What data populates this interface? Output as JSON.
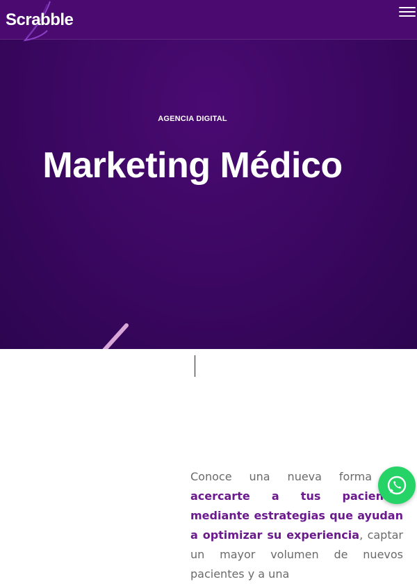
{
  "header": {
    "logo_text": "Scrabble",
    "menu_icon": "hamburger-icon"
  },
  "hero": {
    "eyebrow": "AGENCIA DIGITAL",
    "title": "Marketing Médico"
  },
  "intro": {
    "part1": "Conoce una nueva forma de ",
    "bold": "acercarte a tus pacientes mediante estrategias que ayudan a optimizar su experiencia",
    "part2": ", captar un mayor volumen de nuevos pacientes y a una"
  },
  "floating": {
    "whatsapp_icon": "whatsapp-icon"
  },
  "colors": {
    "hero_bg": "#3a0760",
    "accent": "#6b1a8e",
    "whatsapp": "#25d366"
  }
}
